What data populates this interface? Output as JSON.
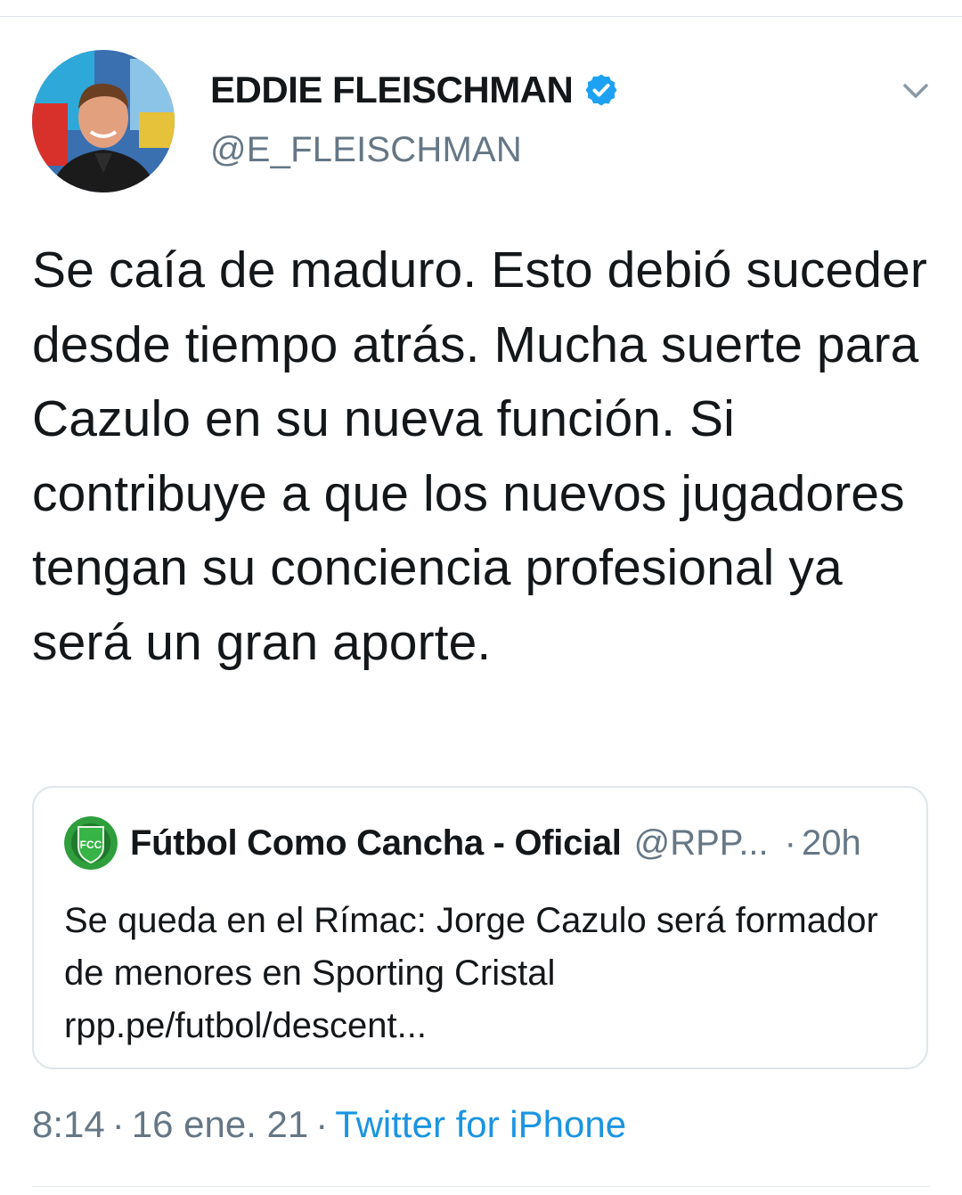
{
  "author": {
    "display_name": "EDDIE FLEISCHMAN",
    "handle": "@E_FLEISCHMAN",
    "verified": true
  },
  "tweet": {
    "text": "Se caía de maduro. Esto debió suceder desde tiempo atrás. Mucha suerte para Cazulo en su nueva función. Si contribuye a que los nuevos jugadores tengan su conciencia profesional ya será un gran aporte."
  },
  "quoted_tweet": {
    "display_name": "Fútbol Como Cancha - Oficial",
    "handle": "@RPP...",
    "separator": "·",
    "time": "20h",
    "avatar_initials": "FCC",
    "text": "Se queda en el Rímac: Jorge Cazulo será formador de menores en Sporting Cristal rpp.pe/futbol/descent..."
  },
  "meta": {
    "time": "8:14",
    "separator": "·",
    "date": "16 ene. 21",
    "source": "Twitter for iPhone"
  },
  "colors": {
    "text_primary": "#14171a",
    "text_secondary": "#657786",
    "link": "#1b95e0",
    "verified": "#1da1f2",
    "border": "#dfe6ea"
  },
  "icons": {
    "verified": "verified-badge-icon",
    "caret": "chevron-down-icon"
  }
}
